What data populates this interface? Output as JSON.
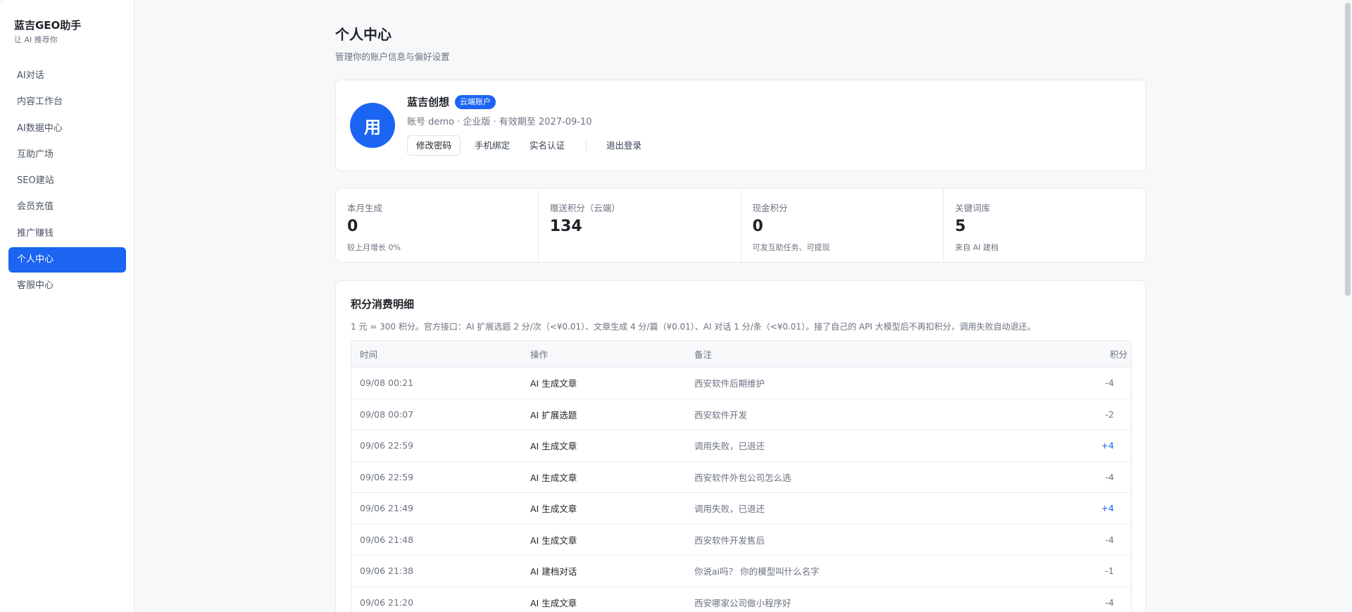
{
  "sidebar": {
    "brand_title": "蓝吉GEO助手",
    "brand_sub": "让 AI 推荐你",
    "items": [
      {
        "label": "AI对话"
      },
      {
        "label": "内容工作台"
      },
      {
        "label": "AI数据中心"
      },
      {
        "label": "互助广场"
      },
      {
        "label": "SEO建站"
      },
      {
        "label": "会员充值"
      },
      {
        "label": "推广赚钱"
      },
      {
        "label": "个人中心",
        "active": true
      },
      {
        "label": "客服中心"
      }
    ]
  },
  "header": {
    "title": "个人中心",
    "subtitle": "管理你的账户信息与偏好设置"
  },
  "profile": {
    "avatar_text": "用",
    "name": "蓝吉创想",
    "badge": "云端账户",
    "meta": "账号 demo · 企业版 · 有效期至 2027-09-10",
    "actions": {
      "change_password": "修改密码",
      "bind_phone": "手机绑定",
      "verify": "实名认证",
      "logout": "退出登录"
    }
  },
  "stats": [
    {
      "label": "本月生成",
      "value": "0",
      "note": "较上月增长 0%"
    },
    {
      "label": "赠送积分（云端）",
      "value": "134",
      "note": ""
    },
    {
      "label": "现金积分",
      "value": "0",
      "note": "可发互助任务、可提现"
    },
    {
      "label": "关键词库",
      "value": "5",
      "note": "来自 AI 建档"
    }
  ],
  "ledger": {
    "title": "积分消费明细",
    "desc": "1 元 = 300 积分。官方接口：AI 扩展选题 2 分/次（<¥0.01）、文章生成 4 分/篇（¥0.01）、AI 对话 1 分/条（<¥0.01）。接了自己的 API 大模型后不再扣积分，调用失败自动退还。",
    "columns": [
      "时间",
      "操作",
      "备注",
      "积分"
    ],
    "rows": [
      {
        "time": "09/08 00:21",
        "op": "AI 生成文章",
        "note": "西安软件后期维护",
        "points": "-4"
      },
      {
        "time": "09/08 00:07",
        "op": "AI 扩展选题",
        "note": "西安软件开发",
        "points": "-2"
      },
      {
        "time": "09/06 22:59",
        "op": "AI 生成文章",
        "note": "调用失败，已退还",
        "points": "+4"
      },
      {
        "time": "09/06 22:59",
        "op": "AI 生成文章",
        "note": "西安软件外包公司怎么选",
        "points": "-4"
      },
      {
        "time": "09/06 21:49",
        "op": "AI 生成文章",
        "note": "调用失败，已退还",
        "points": "+4"
      },
      {
        "time": "09/06 21:48",
        "op": "AI 生成文章",
        "note": "西安软件开发售后",
        "points": "-4"
      },
      {
        "time": "09/06 21:38",
        "op": "AI 建档对话",
        "note": "你说ai吗？ 你的模型叫什么名字",
        "points": "-1"
      },
      {
        "time": "09/06 21:20",
        "op": "AI 生成文章",
        "note": "西安哪家公司做小程序好",
        "points": "-4"
      }
    ]
  },
  "colors": {
    "accent": "#1c64f2",
    "positive_points": "#1c64f2"
  }
}
